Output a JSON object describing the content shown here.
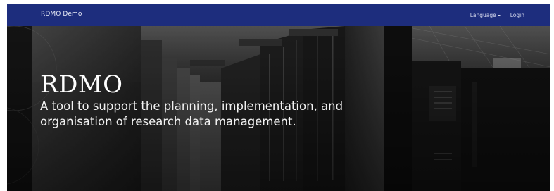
{
  "navbar": {
    "brand": "RDMO Demo",
    "language_label": "Language",
    "login_label": "Login",
    "background_color": "#1d2d7d"
  },
  "hero": {
    "title": "RDMO",
    "subtitle": "A tool to support the planning, implementation, and organisation of research data management.",
    "background_image": "server-racks-photo"
  },
  "icons": {
    "language_dropdown": "caret-down-icon"
  }
}
